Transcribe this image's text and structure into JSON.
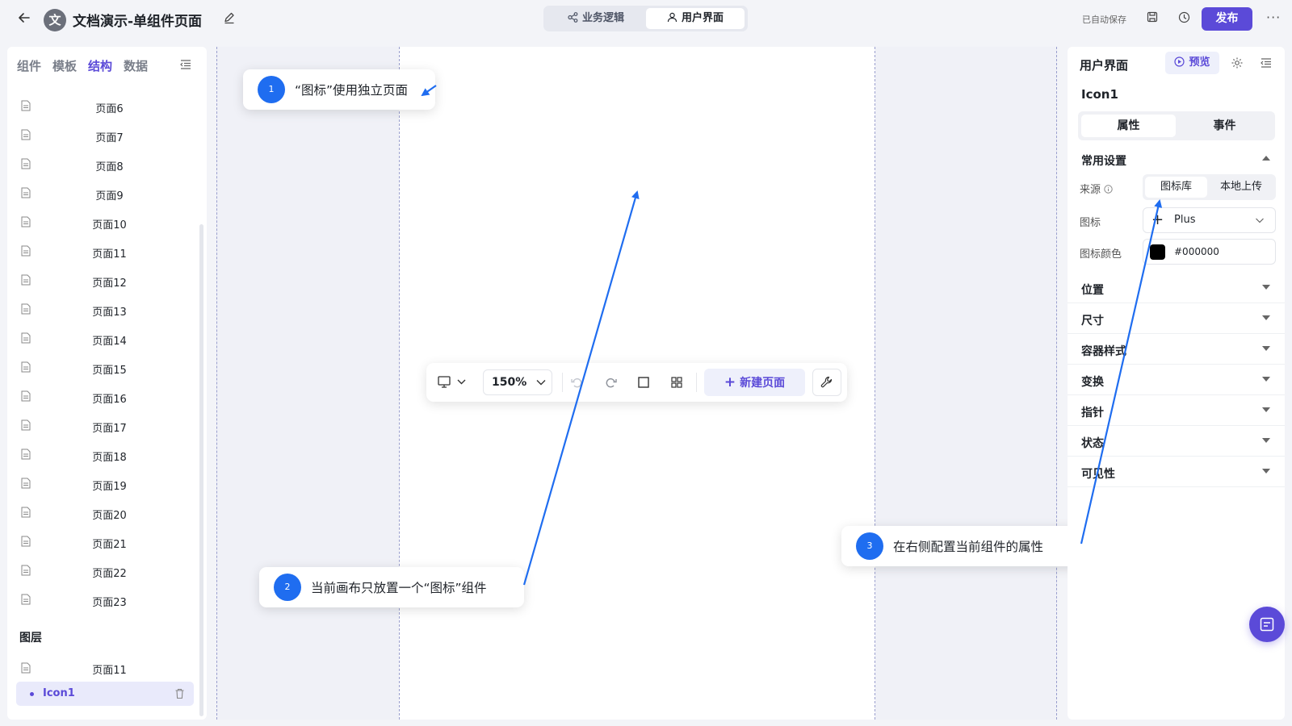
{
  "header": {
    "avatar_letter": "文",
    "title": "文档演示-单组件页面",
    "modes": [
      "业务逻辑",
      "用户界面"
    ],
    "autosave": "已自动保存",
    "publish": "发布",
    "more": "···"
  },
  "left_panel": {
    "tabs": [
      "组件",
      "模板",
      "结构",
      "数据"
    ],
    "active_tab": "结构",
    "pages": [
      "页面6",
      "页面7",
      "页面8",
      "页面9",
      "页面10",
      "页面11",
      "页面12",
      "页面13",
      "页面14",
      "页面15",
      "页面16",
      "页面17",
      "页面18",
      "页面19",
      "页面20",
      "页面21",
      "页面22",
      "页面23"
    ],
    "layers_title": "图层",
    "layer_page": "页面11",
    "layer_selected": "Icon1"
  },
  "toolbar": {
    "zoom": "150%",
    "new_page": "新建页面"
  },
  "callouts": [
    {
      "num": "1",
      "text": "“图标”使用独立页面"
    },
    {
      "num": "2",
      "text": "当前画布只放置一个“图标”组件"
    },
    {
      "num": "3",
      "text": "在右侧配置当前组件的属性"
    }
  ],
  "right_panel": {
    "title": "用户界面",
    "preview": "预览",
    "component_name": "Icon1",
    "tabs": [
      "属性",
      "事件"
    ],
    "common_section": "常用设置",
    "source_label": "来源",
    "source_options": [
      "图标库",
      "本地上传"
    ],
    "icon_label": "图标",
    "icon_value": "Plus",
    "color_label": "图标颜色",
    "color_value": "#000000",
    "sections": [
      "位置",
      "尺寸",
      "容器样式",
      "变换",
      "指针",
      "状态",
      "可见性"
    ]
  },
  "colors": {
    "accent": "#5b4ad8",
    "annotation_blue": "#1f6df0"
  }
}
